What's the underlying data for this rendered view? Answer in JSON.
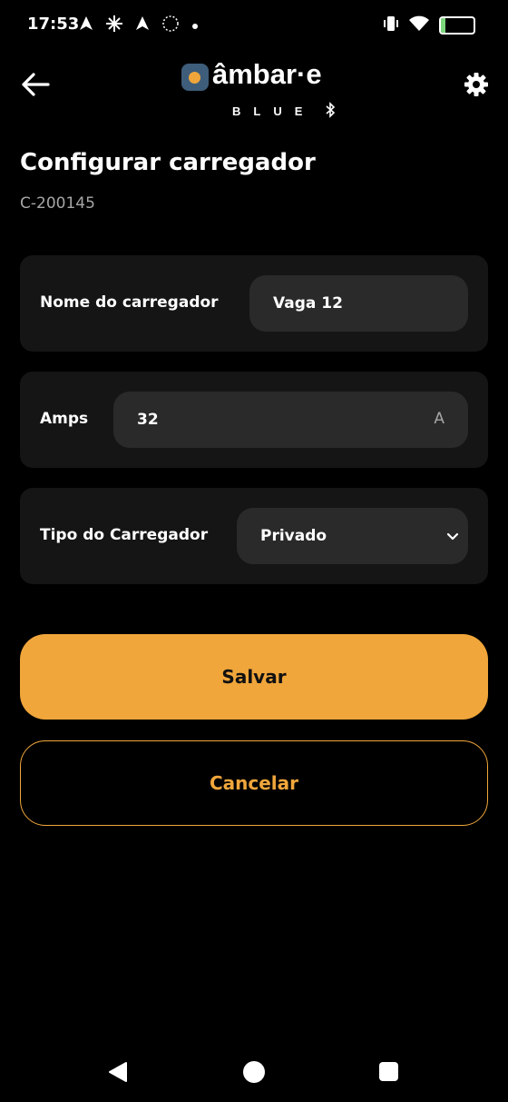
{
  "status_bar": {
    "time": "17:53",
    "battery": "14",
    "battery_level": 0.14,
    "icons_left": [
      "navigation-icon",
      "sparkle-icon",
      "navigation-icon",
      "settings-dots-icon",
      "dot-icon"
    ],
    "icons_right": [
      "vibrate-icon",
      "wifi-icon",
      "battery-icon"
    ]
  },
  "app_bar": {
    "logo_text": "âmbar·e",
    "logo_sub": "BLUE"
  },
  "page": {
    "title": "Configurar carregador",
    "subtitle": "C-200145"
  },
  "form": {
    "name": {
      "label": "Nome do carregador",
      "value": "Vaga 12"
    },
    "amps": {
      "label": "Amps",
      "value": "32",
      "unit": "A"
    },
    "type": {
      "label": "Tipo do Carregador",
      "value": "Privado"
    }
  },
  "buttons": {
    "save": "Salvar",
    "cancel": "Cancelar"
  },
  "colors": {
    "accent": "#f0a63b",
    "background": "#000000",
    "card": "#151515",
    "field": "#2a2a2a",
    "muted_text": "#a6a6a6"
  }
}
